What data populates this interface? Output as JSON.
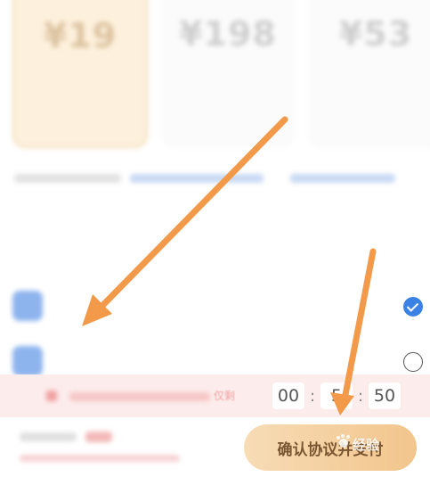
{
  "colors": {
    "accent_blue": "#3c82e6",
    "gold_selected": "#fdf0dc",
    "banner_bg": "#fdecec",
    "button_gold": "#f2c58c",
    "annotation_arrow": "#f29a4a"
  },
  "plans": [
    {
      "old_price": "",
      "price": "¥19",
      "tag": "",
      "desc": "",
      "selected": true
    },
    {
      "old_price": "",
      "price": "¥198",
      "tag": "",
      "desc": "",
      "selected": false
    },
    {
      "old_price": "",
      "price": "¥53",
      "tag": "",
      "desc": "",
      "selected": false
    }
  ],
  "payment": {
    "title": "",
    "methods": [
      {
        "label": "",
        "badge": "",
        "checked": true,
        "icon": "pay-app-icon"
      },
      {
        "label": "",
        "checked": false,
        "icon": "pay-app-icon"
      }
    ]
  },
  "banner": {
    "text": "仅剩",
    "countdown": {
      "hours": "00",
      "minutes": "5",
      "seconds": "50"
    }
  },
  "bottom": {
    "confirm_label": "确认协议并支付"
  },
  "watermark": "经验",
  "annotations": {
    "arrow_count": 2,
    "icon": "arrow-annotation"
  }
}
